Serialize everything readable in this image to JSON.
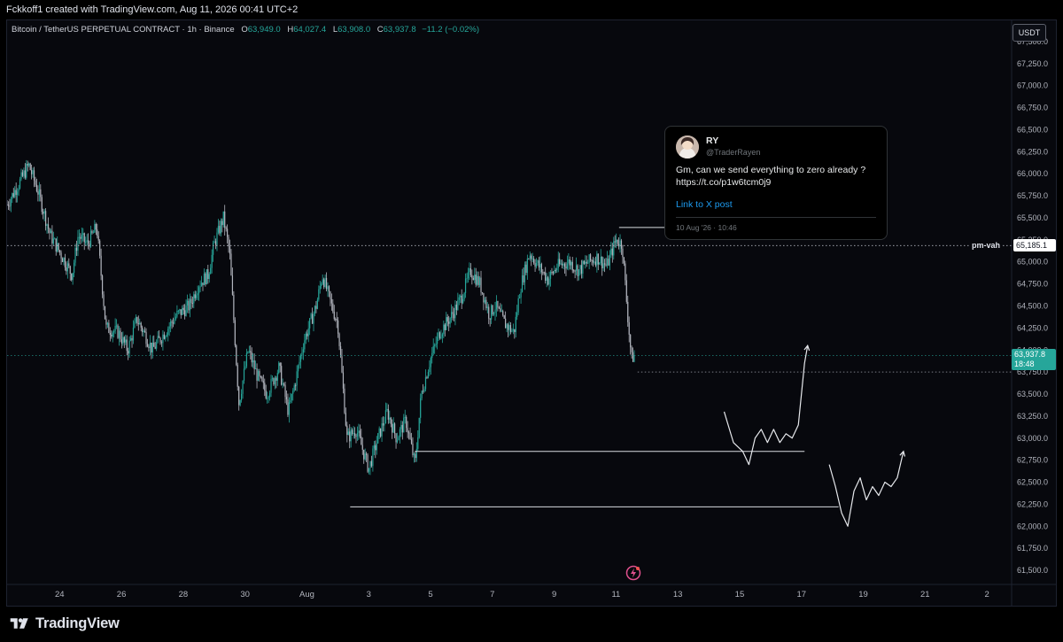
{
  "header": {
    "credit": "Fckkoff1 created with TradingView.com, Aug 11, 2026 00:41 UTC+2"
  },
  "legend": {
    "symbol": "Bitcoin / TetherUS PERPETUAL CONTRACT · 1h · Binance",
    "open_label": "O",
    "open": "63,949.0",
    "high_label": "H",
    "high": "64,027.4",
    "low_label": "L",
    "low": "63,908.0",
    "close_label": "C",
    "close": "63,937.8",
    "change": "−11.2 (−0.02%)"
  },
  "currency_button": "USDT",
  "price_axis": {
    "labels": [
      "67,500.0",
      "67,250.0",
      "67,000.0",
      "66,750.0",
      "66,500.0",
      "66,250.0",
      "66,000.0",
      "65,750.0",
      "65,500.0",
      "65,250.0",
      "65,000.0",
      "64,750.0",
      "64,500.0",
      "64,250.0",
      "64,000.0",
      "63,750.0",
      "63,500.0",
      "63,250.0",
      "63,000.0",
      "62,750.0",
      "62,500.0",
      "62,250.0",
      "62,000.0",
      "61,750.0",
      "61,500.0"
    ],
    "values": [
      67500,
      67250,
      67000,
      66750,
      66500,
      66250,
      66000,
      65750,
      65500,
      65250,
      65000,
      64750,
      64500,
      64250,
      64000,
      63750,
      63500,
      63250,
      63000,
      62750,
      62500,
      62250,
      62000,
      61750,
      61500
    ]
  },
  "time_axis": {
    "labels": [
      "24",
      "26",
      "28",
      "30",
      "Aug",
      "3",
      "5",
      "7",
      "9",
      "11",
      "13",
      "15",
      "17",
      "19",
      "21",
      "2"
    ],
    "days": [
      -8,
      -6,
      -4,
      -2,
      0,
      2,
      4,
      6,
      8,
      10,
      12,
      14,
      16,
      18,
      20,
      22
    ]
  },
  "markers": {
    "vah_label": "pm-vah",
    "vah_value": "65,185.1",
    "vah_price": 65185.1,
    "last_price": "63,937.8",
    "last_price_value": 63937.8,
    "countdown": "18:48"
  },
  "tweet": {
    "name": "RY",
    "handle": "@TraderRayen",
    "text": "Gm, can we send everything to zero already ? https://t.co/p1w6tcm0j9",
    "link_label": "Link to X post",
    "date": "10 Aug '26 · 10:46"
  },
  "brand": {
    "name": "TradingView"
  },
  "colors": {
    "up": "#26a69a",
    "down": "#b2b5be",
    "price_badge": "#26a69a",
    "vah_badge": "#ffffff",
    "background": "#07080d",
    "link": "#1d9bf0"
  },
  "icons": [
    "tradingview-logo-icon",
    "lightning-icon",
    "avatar-icon"
  ],
  "chart_data": {
    "type": "candlestick",
    "interval": "1h",
    "y_unit": "USDT",
    "ylim": [
      61350,
      67700
    ],
    "x_unit": "days relative to Aug 1, 2026",
    "xlim": [
      -9.7,
      22.8
    ],
    "path_anchors": [
      [
        -9.7,
        65650
      ],
      [
        -9.3,
        65900
      ],
      [
        -9.0,
        66100
      ],
      [
        -8.7,
        65800
      ],
      [
        -8.3,
        65300
      ],
      [
        -7.9,
        65050
      ],
      [
        -7.6,
        64850
      ],
      [
        -7.4,
        65300
      ],
      [
        -7.1,
        65200
      ],
      [
        -6.8,
        65400
      ],
      [
        -6.5,
        64250
      ],
      [
        -6.1,
        64200
      ],
      [
        -5.8,
        64000
      ],
      [
        -5.5,
        64350
      ],
      [
        -5.2,
        64150
      ],
      [
        -5.0,
        64000
      ],
      [
        -4.6,
        64200
      ],
      [
        -4.2,
        64400
      ],
      [
        -3.8,
        64500
      ],
      [
        -3.5,
        64750
      ],
      [
        -3.2,
        64850
      ],
      [
        -3.0,
        65200
      ],
      [
        -2.7,
        65500
      ],
      [
        -2.5,
        65100
      ],
      [
        -2.2,
        63400
      ],
      [
        -1.9,
        64000
      ],
      [
        -1.6,
        63700
      ],
      [
        -1.3,
        63500
      ],
      [
        -0.9,
        63800
      ],
      [
        -0.6,
        63300
      ],
      [
        -0.4,
        63600
      ],
      [
        -0.1,
        64100
      ],
      [
        0.3,
        64500
      ],
      [
        0.5,
        64850
      ],
      [
        0.8,
        64500
      ],
      [
        1.0,
        64300
      ],
      [
        1.3,
        63000
      ],
      [
        1.6,
        63100
      ],
      [
        2.0,
        62650
      ],
      [
        2.3,
        63000
      ],
      [
        2.6,
        63300
      ],
      [
        2.9,
        63000
      ],
      [
        3.2,
        63200
      ],
      [
        3.5,
        62700
      ],
      [
        3.7,
        63500
      ],
      [
        4.0,
        63900
      ],
      [
        4.3,
        64200
      ],
      [
        4.7,
        64400
      ],
      [
        5.0,
        64600
      ],
      [
        5.3,
        64900
      ],
      [
        5.6,
        64750
      ],
      [
        5.9,
        64400
      ],
      [
        6.1,
        64500
      ],
      [
        6.4,
        64300
      ],
      [
        6.7,
        64200
      ],
      [
        6.9,
        64700
      ],
      [
        7.2,
        65100
      ],
      [
        7.5,
        64950
      ],
      [
        7.8,
        64800
      ],
      [
        8.1,
        64950
      ],
      [
        8.5,
        65000
      ],
      [
        8.8,
        64900
      ],
      [
        9.1,
        65000
      ],
      [
        9.4,
        65050
      ],
      [
        9.7,
        64950
      ],
      [
        10.0,
        65250
      ],
      [
        10.2,
        65200
      ],
      [
        10.4,
        64300
      ],
      [
        10.5,
        63900
      ],
      [
        10.6,
        63940
      ]
    ],
    "horizontal_levels": [
      {
        "price": 63750,
        "from_day": 10.7,
        "to_day": 22.8,
        "style": "dotted"
      },
      {
        "price": 62850,
        "from_day": 3.5,
        "to_day": 16.1,
        "style": "solid"
      },
      {
        "price": 62220,
        "from_day": 1.4,
        "to_day": 17.2,
        "style": "solid"
      },
      {
        "price": 65390,
        "from_day": 10.1,
        "to_day": 14.5,
        "style": "solid"
      }
    ],
    "projections": [
      [
        [
          13.5,
          63300
        ],
        [
          13.8,
          62950
        ],
        [
          14.1,
          62850
        ],
        [
          14.3,
          62700
        ],
        [
          14.5,
          63000
        ],
        [
          14.7,
          63100
        ],
        [
          14.9,
          62950
        ],
        [
          15.1,
          63100
        ],
        [
          15.3,
          62950
        ],
        [
          15.5,
          63050
        ],
        [
          15.7,
          63000
        ],
        [
          15.9,
          63150
        ],
        [
          16.1,
          63850
        ],
        [
          16.2,
          64050
        ]
      ],
      [
        [
          16.9,
          62700
        ],
        [
          17.1,
          62450
        ],
        [
          17.3,
          62150
        ],
        [
          17.5,
          62000
        ],
        [
          17.7,
          62400
        ],
        [
          17.9,
          62550
        ],
        [
          18.1,
          62300
        ],
        [
          18.3,
          62450
        ],
        [
          18.5,
          62350
        ],
        [
          18.7,
          62500
        ],
        [
          18.9,
          62450
        ],
        [
          19.1,
          62550
        ],
        [
          19.3,
          62850
        ]
      ]
    ]
  }
}
